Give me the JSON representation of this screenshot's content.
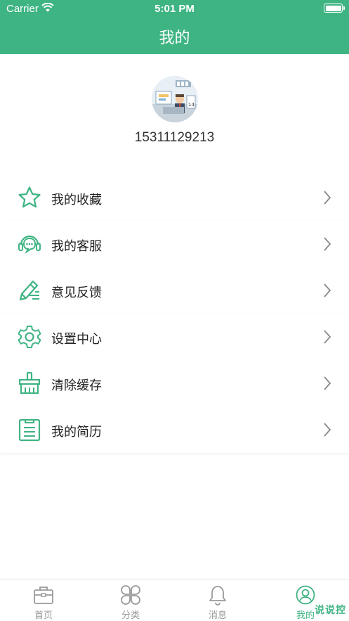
{
  "status_bar": {
    "carrier": "Carrier",
    "time": "5:01 PM"
  },
  "header": {
    "title": "我的"
  },
  "profile": {
    "phone": "15311129213"
  },
  "menu": {
    "items": [
      {
        "label": "我的收藏",
        "icon": "star-icon"
      },
      {
        "label": "我的客服",
        "icon": "headset-icon"
      },
      {
        "label": "意见反馈",
        "icon": "feedback-pen-icon"
      },
      {
        "label": "设置中心",
        "icon": "gear-icon"
      },
      {
        "label": "清除缓存",
        "icon": "broom-icon"
      },
      {
        "label": "我的简历",
        "icon": "resume-icon"
      }
    ]
  },
  "tabbar": {
    "tabs": [
      {
        "label": "首页",
        "icon": "briefcase-icon"
      },
      {
        "label": "分类",
        "icon": "grid-icon"
      },
      {
        "label": "消息",
        "icon": "bell-icon"
      },
      {
        "label": "我的",
        "icon": "user-icon",
        "active": true
      }
    ]
  },
  "watermark": "说说控",
  "colors": {
    "accent": "#3fb483",
    "inactive": "#999999"
  }
}
